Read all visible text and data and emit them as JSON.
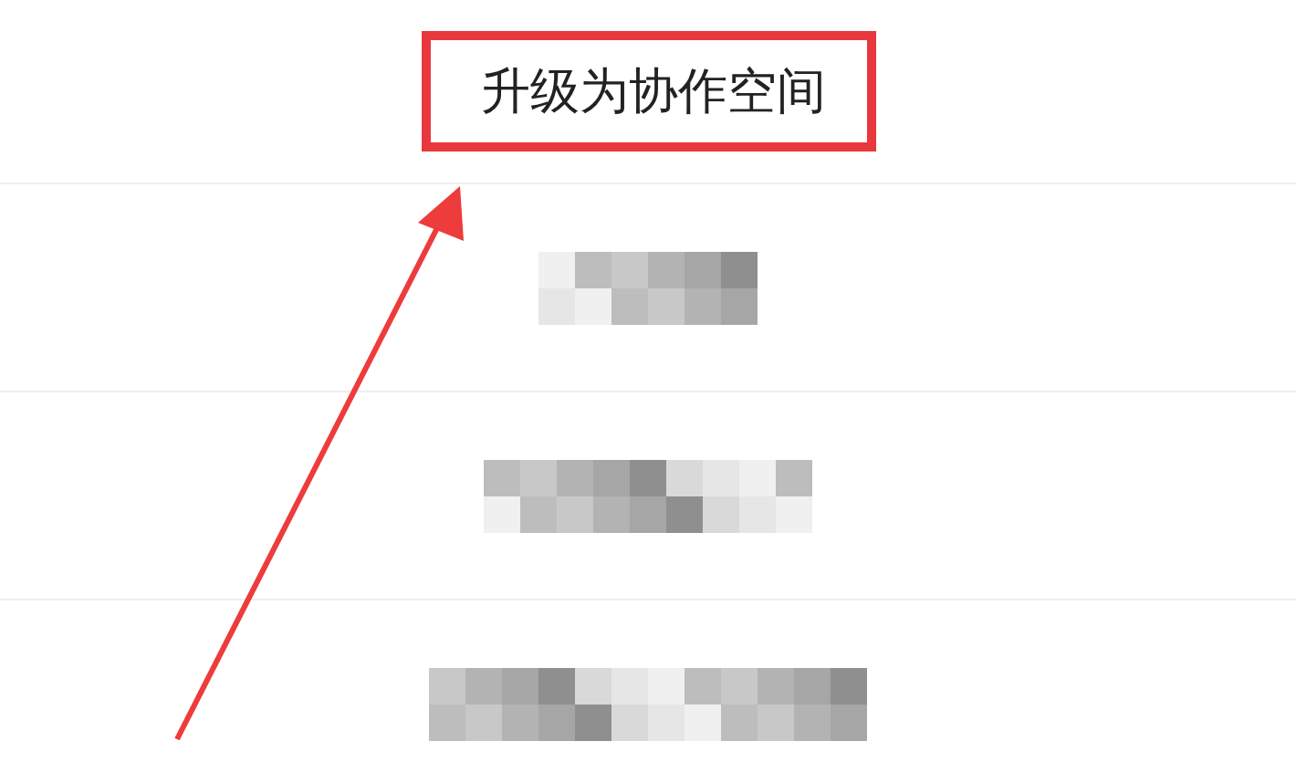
{
  "menu": {
    "title": "升级为协作空间",
    "highlighted": true
  },
  "items": [
    {
      "kind": "obscured"
    },
    {
      "kind": "obscured"
    },
    {
      "kind": "obscured"
    }
  ],
  "annotation": {
    "arrow": true
  }
}
